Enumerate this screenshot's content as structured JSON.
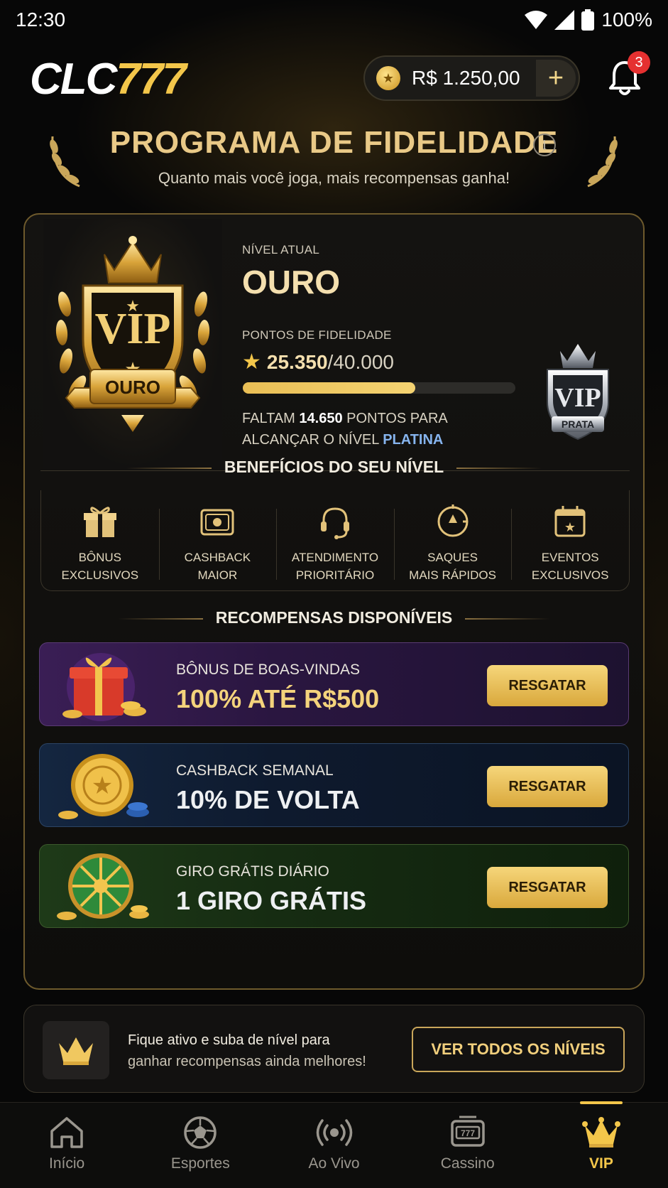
{
  "status_bar": {
    "time": "12:30",
    "battery": "100%"
  },
  "header": {
    "logo_part1": "CLC",
    "logo_part2": "777",
    "balance": "R$ 1.250,00",
    "add_label": "+",
    "notifications_count": "3"
  },
  "program": {
    "title": "PROGRAMA DE FIDELIDADE",
    "info": "i",
    "subtitle": "Quanto mais você joga, mais recompensas ganha!"
  },
  "level": {
    "badge_text": "VIP",
    "badge_ribbon": "OURO",
    "current_label": "NÍVEL ATUAL",
    "current_name": "OURO",
    "points_label": "PONTOS DE FIDELIDADE",
    "points_current": "25.350",
    "points_total": "/40.000",
    "progress_fraction": 0.634,
    "remaining_prefix": "FALTAM ",
    "remaining_points": "14.650",
    "remaining_mid": " PONTOS PARA",
    "remaining_line2": "ALCANÇAR O NÍVEL ",
    "next_level": "PLATINA",
    "next_badge_text": "VIP",
    "next_badge_ribbon": "PRATA"
  },
  "benefits": {
    "title": "BENEFÍCIOS DO SEU NÍVEL",
    "items": [
      {
        "line1": "BÔNUS",
        "line2": "EXCLUSIVOS",
        "icon": "gift-icon"
      },
      {
        "line1": "CASHBACK",
        "line2": "MAIOR",
        "icon": "cashback-icon"
      },
      {
        "line1": "ATENDIMENTO",
        "line2": "PRIORITÁRIO",
        "icon": "headset-icon"
      },
      {
        "line1": "SAQUES",
        "line2": "MAIS RÁPIDOS",
        "icon": "fast-withdraw-icon"
      },
      {
        "line1": "EVENTOS",
        "line2": "EXCLUSIVOS",
        "icon": "calendar-star-icon"
      }
    ]
  },
  "rewards": {
    "title": "RECOMPENSAS DISPONÍVEIS",
    "items": [
      {
        "subtitle": "BÔNUS DE BOAS-VINDAS",
        "title": "100% ATÉ R$500",
        "button": "RESGATAR",
        "art": "gift-box-icon"
      },
      {
        "subtitle": "CASHBACK SEMANAL",
        "title": "10% DE VOLTA",
        "button": "RESGATAR",
        "art": "gold-coin-icon"
      },
      {
        "subtitle": "GIRO GRÁTIS DIÁRIO",
        "title": "1 GIRO GRÁTIS",
        "button": "RESGATAR",
        "art": "prize-wheel-icon"
      }
    ]
  },
  "promo": {
    "line1": "Fique ativo e suba de nível para",
    "line2": "ganhar recompensas ainda melhores!",
    "button": "VER TODOS OS NÍVEIS"
  },
  "nav": {
    "items": [
      {
        "label": "Início",
        "icon": "home-icon"
      },
      {
        "label": "Esportes",
        "icon": "soccer-ball-icon"
      },
      {
        "label": "Ao Vivo",
        "icon": "live-broadcast-icon"
      },
      {
        "label": "Cassino",
        "icon": "slot-machine-icon"
      },
      {
        "label": "VIP",
        "icon": "crown-icon",
        "active": true
      }
    ]
  },
  "colors": {
    "gold": "#f3c64a",
    "next_level_blue": "#86b4ee",
    "badge_red": "#e53030"
  }
}
